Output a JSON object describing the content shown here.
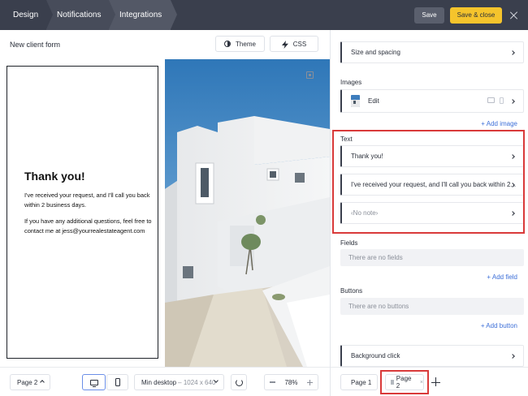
{
  "topbar": {
    "tabs": [
      {
        "label": "Design"
      },
      {
        "label": "Notifications"
      },
      {
        "label": "Integrations"
      }
    ],
    "save_label": "Save",
    "save_close_label": "Save & close",
    "accent_color": "#f5c42c"
  },
  "editor": {
    "form_title": "New client form",
    "theme_label": "Theme",
    "css_label": "CSS"
  },
  "preview": {
    "heading": "Thank you!",
    "paragraph1": "I've received your request, and I'll call you back within 2 business days.",
    "paragraph2": "If you have any additional questions, feel free to contact me at jess@yourrealestateagent.com"
  },
  "toolbar": {
    "page_select": "Page 2",
    "resolution_main": "Min desktop",
    "resolution_sub": "– 1024 x 640",
    "zoom": "78%"
  },
  "panel": {
    "size_spacing": "Size and spacing",
    "images_label": "Images",
    "image_item": "Edit",
    "add_image": "+ Add image",
    "text_label": "Text",
    "text_items": [
      "Thank you!",
      "I've received your request, and I'll call you back within 2...",
      "‹No note›"
    ],
    "fields_label": "Fields",
    "fields_empty": "There are no fields",
    "add_field": "+ Add field",
    "buttons_label": "Buttons",
    "buttons_empty": "There are no buttons",
    "add_button": "+ Add button",
    "background_click": "Background click"
  },
  "pages": {
    "tabs": [
      {
        "label": "Page 1"
      },
      {
        "label": "Page 2"
      }
    ],
    "close_glyph": "×"
  },
  "icons": {
    "close": "close-icon",
    "theme": "contrast-icon",
    "css": "lightning-icon",
    "desktop": "desktop-icon",
    "mobile": "mobile-icon",
    "refresh": "refresh-icon",
    "add": "plus-icon"
  }
}
